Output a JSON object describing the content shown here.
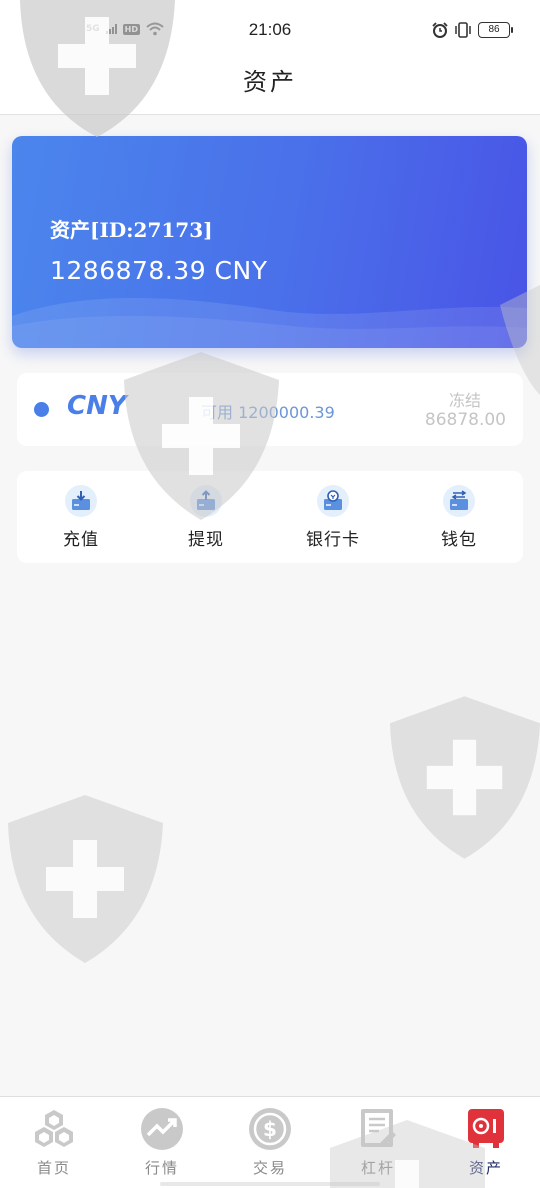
{
  "status_bar": {
    "network": "5G",
    "hd": "HD",
    "time": "21:06",
    "battery": "86"
  },
  "header": {
    "title": "资产"
  },
  "asset_card": {
    "label": "资产[ID:27173]",
    "total": "1286878.39 CNY"
  },
  "currency": {
    "name": "CNY",
    "available": "可用 1200000.39",
    "frozen_label": "冻结",
    "frozen_value": "86878.00"
  },
  "actions": [
    {
      "label": "充值",
      "icon": "deposit-icon"
    },
    {
      "label": "提现",
      "icon": "withdraw-icon"
    },
    {
      "label": "银行卡",
      "icon": "bank-card-icon"
    },
    {
      "label": "钱包",
      "icon": "wallet-icon"
    }
  ],
  "bottom_nav": [
    {
      "label": "首页",
      "icon": "home-cube-icon"
    },
    {
      "label": "行情",
      "icon": "market-trend-icon"
    },
    {
      "label": "交易",
      "icon": "dollar-coin-icon"
    },
    {
      "label": "杠杆",
      "icon": "document-icon"
    },
    {
      "label": "资产",
      "icon": "safe-box-icon",
      "active": true
    }
  ],
  "colors": {
    "accent": "#4a7fe8",
    "card_gradient_start": "#4b86ec",
    "card_gradient_end": "#4954e6",
    "active_nav": "#e0323a"
  }
}
